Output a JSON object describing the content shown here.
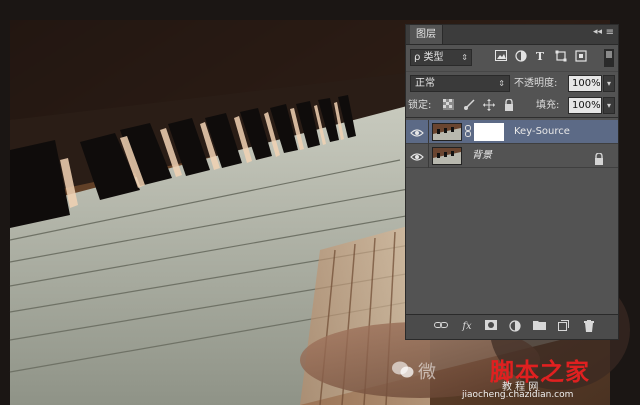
{
  "panel": {
    "tab_label": "图层",
    "collapse_glyph": "◂◂",
    "menu_glyph": "≡",
    "filter": {
      "kind_glyph": "ρ",
      "kind_label": "类型",
      "icons": [
        "image-filter-icon",
        "adjustment-filter-icon",
        "type-filter-icon",
        "shape-filter-icon",
        "smart-object-filter-icon"
      ]
    },
    "blend_mode": "正常",
    "opacity_label": "不透明度:",
    "opacity_value": "100%",
    "lock_label": "锁定:",
    "fill_label": "填充:",
    "fill_value": "100%",
    "layers": [
      {
        "name": "Key-Source",
        "visible": true,
        "selected": true,
        "has_mask": true,
        "locked": false
      },
      {
        "name": "背景",
        "visible": true,
        "selected": false,
        "has_mask": false,
        "locked": true
      }
    ],
    "footer_icons": [
      "link-layers-icon",
      "fx-icon",
      "add-mask-icon",
      "adjustment-layer-icon",
      "new-group-icon",
      "new-layer-icon",
      "delete-layer-icon"
    ],
    "fx_label": "fx"
  },
  "watermark": {
    "wechat_text": "微",
    "brand": "脚本之家",
    "tagline": "教 程 网",
    "url": "jiaocheng.chazidian.com"
  },
  "colors": {
    "panel_bg": "#535353",
    "selected_layer": "#5c6a86",
    "brand_red": "#e02020"
  }
}
